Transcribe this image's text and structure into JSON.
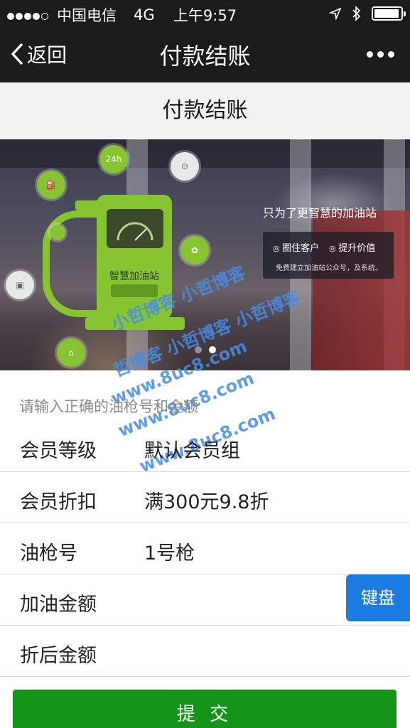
{
  "status_bar": {
    "carrier": "中国电信",
    "network": "4G",
    "time": "上午9:57",
    "signal_bars_filled": 4,
    "signal_bars_total": 5,
    "battery_level": 0.95
  },
  "nav": {
    "back_label": "返回",
    "title": "付款结账"
  },
  "page_header": {
    "title": "付款结账"
  },
  "banner": {
    "pump_label": "智慧加油站",
    "badge_24h": "24h",
    "slogan": "只为了更智慧的加油站",
    "features": [
      "圈住客户",
      "提升价值"
    ],
    "desc": "免费建立加油站公众号，及系统。",
    "slide_count": 2,
    "active_slide": 1,
    "watermarks": [
      "小哲博客 小哲博客",
      "哲博客 小哲博客 小哲博客",
      "www.8uc8.com",
      "www.8uc8.com",
      "www.8uc8.com"
    ]
  },
  "form": {
    "hint": "请输入正确的油枪号和金额",
    "rows": [
      {
        "label": "会员等级",
        "value": "默认会员组"
      },
      {
        "label": "会员折扣",
        "value": "满300元9.8折"
      },
      {
        "label": "油枪号",
        "value": "1号枪"
      },
      {
        "label": "加油金额",
        "value": ""
      },
      {
        "label": "折后金额",
        "value": ""
      }
    ],
    "keyboard_button": "键盘",
    "submit_label": "提 交"
  },
  "colors": {
    "nav_bg": "#1b1b1b",
    "submit_green": "#14951a",
    "keyboard_blue": "#1b7be0",
    "pump_green": "#86c531",
    "watermark_blue": "#468ce6"
  }
}
